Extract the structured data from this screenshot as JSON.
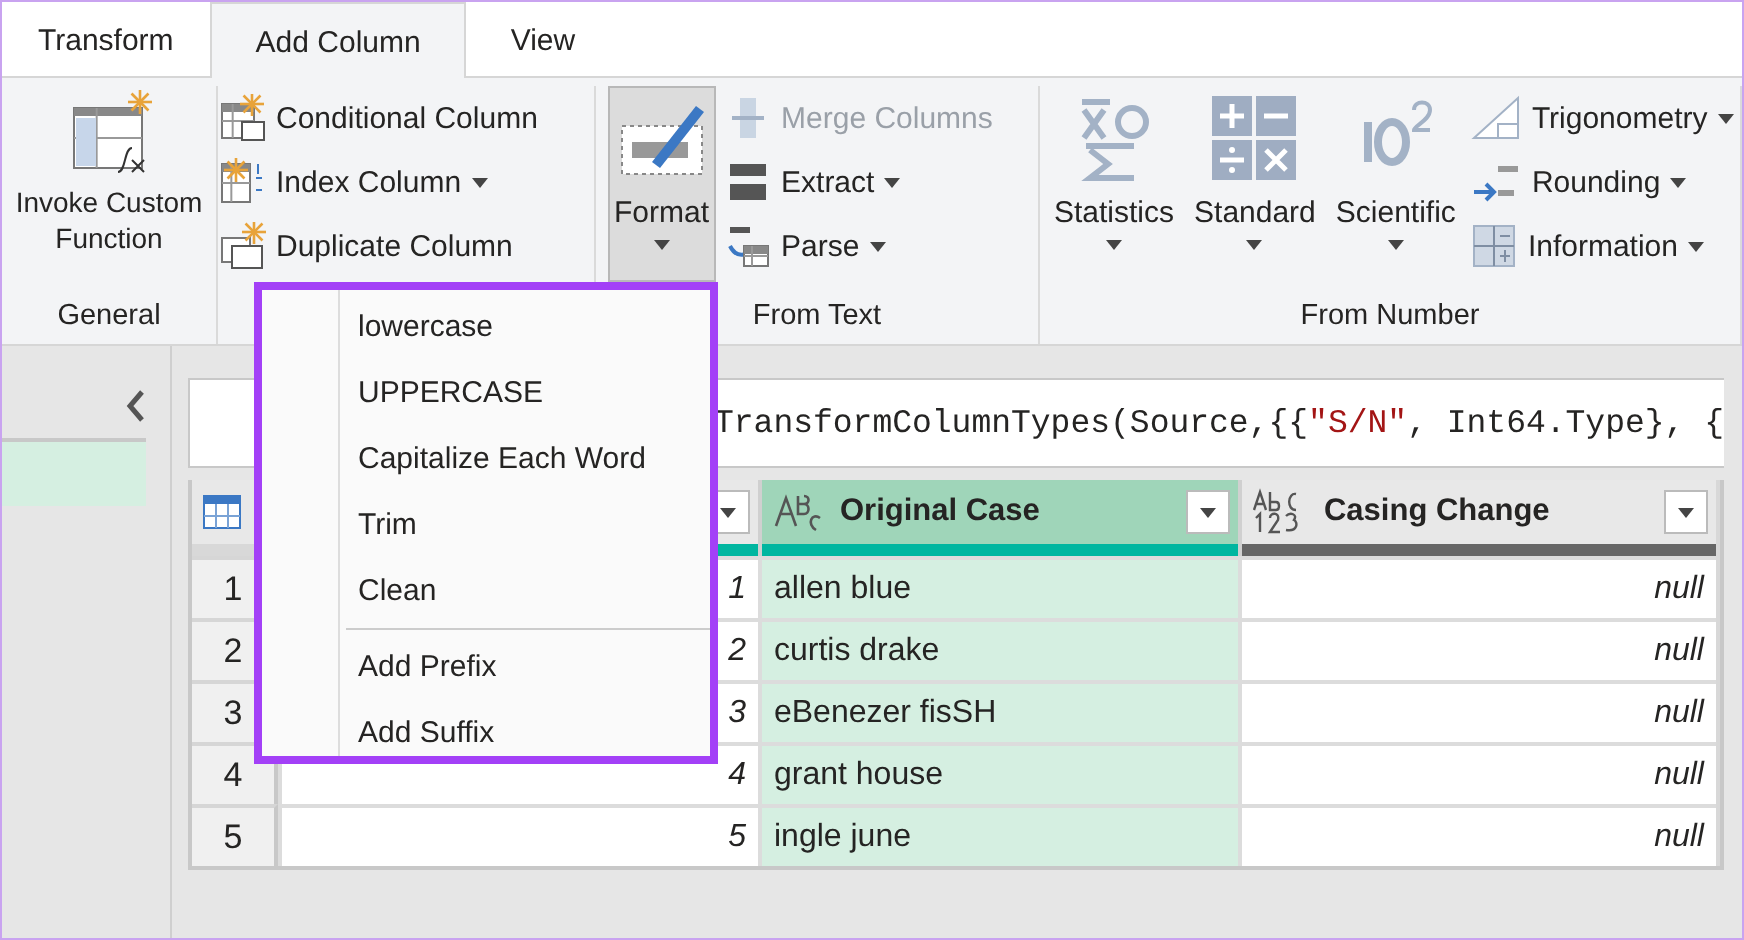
{
  "tabs": [
    {
      "label": "Transform",
      "selected": false
    },
    {
      "label": "Add Column",
      "selected": true
    },
    {
      "label": "View",
      "selected": false
    }
  ],
  "ribbon": {
    "groups": [
      {
        "label": "General",
        "items": [
          {
            "kind": "large",
            "label": "Invoke Custom Function",
            "dropdown": false,
            "pressed": false,
            "disabled": false
          }
        ]
      },
      {
        "items": [
          {
            "kind": "small",
            "label": "Conditional Column",
            "dropdown": false,
            "disabled": false
          },
          {
            "kind": "small",
            "label": "Index Column",
            "dropdown": true,
            "disabled": false
          },
          {
            "kind": "small",
            "label": "Duplicate Column",
            "dropdown": false,
            "disabled": false
          }
        ]
      },
      {
        "label": "From Text",
        "items": [
          {
            "kind": "large",
            "label": "Format",
            "dropdown": true,
            "pressed": true,
            "disabled": false
          },
          {
            "kind": "small",
            "label": "Merge Columns",
            "dropdown": false,
            "disabled": true
          },
          {
            "kind": "small",
            "label": "Extract",
            "dropdown": true,
            "disabled": false
          },
          {
            "kind": "small",
            "label": "Parse",
            "dropdown": true,
            "disabled": false
          }
        ]
      },
      {
        "label": "From Number",
        "items": [
          {
            "kind": "large",
            "label": "Statistics",
            "dropdown": true,
            "pressed": false,
            "disabled": false
          },
          {
            "kind": "large",
            "label": "Standard",
            "dropdown": true,
            "pressed": false,
            "disabled": false
          },
          {
            "kind": "large",
            "label": "Scientific",
            "dropdown": true,
            "pressed": false,
            "disabled": false
          },
          {
            "kind": "small",
            "label": "Trigonometry",
            "dropdown": true,
            "disabled": false
          },
          {
            "kind": "small",
            "label": "Rounding",
            "dropdown": true,
            "disabled": false
          },
          {
            "kind": "small",
            "label": "Information",
            "dropdown": true,
            "disabled": false
          }
        ]
      }
    ]
  },
  "format_menu": {
    "sections": [
      [
        "lowercase",
        "UPPERCASE",
        "Capitalize Each Word",
        "Trim",
        "Clean"
      ],
      [
        "Add Prefix",
        "Add Suffix"
      ]
    ]
  },
  "formula_bar": {
    "segments": [
      {
        "kind": "code",
        "text": "TransformColumnTypes(Source,{{"
      },
      {
        "kind": "string",
        "text": "\"S/N\""
      },
      {
        "kind": "code",
        "text": ", Int64.Type}, {"
      }
    ]
  },
  "table": {
    "columns": [
      {
        "kind": "integer",
        "selected": false
      },
      {
        "kind": "text",
        "label": "Original Case",
        "selected": true
      },
      {
        "kind": "any",
        "label": "Casing Change",
        "selected": false
      }
    ],
    "rows": [
      {
        "number": "1",
        "cells": [
          "1",
          "allen blue",
          "null"
        ]
      },
      {
        "number": "2",
        "cells": [
          "2",
          "curtis drake",
          "null"
        ]
      },
      {
        "number": "3",
        "cells": [
          "3",
          "eBenezer fisSH",
          "null"
        ]
      },
      {
        "number": "4",
        "cells": [
          "4",
          "grant house",
          "null"
        ]
      },
      {
        "number": "5",
        "cells": [
          "5",
          "ingle june",
          "null"
        ]
      }
    ]
  }
}
